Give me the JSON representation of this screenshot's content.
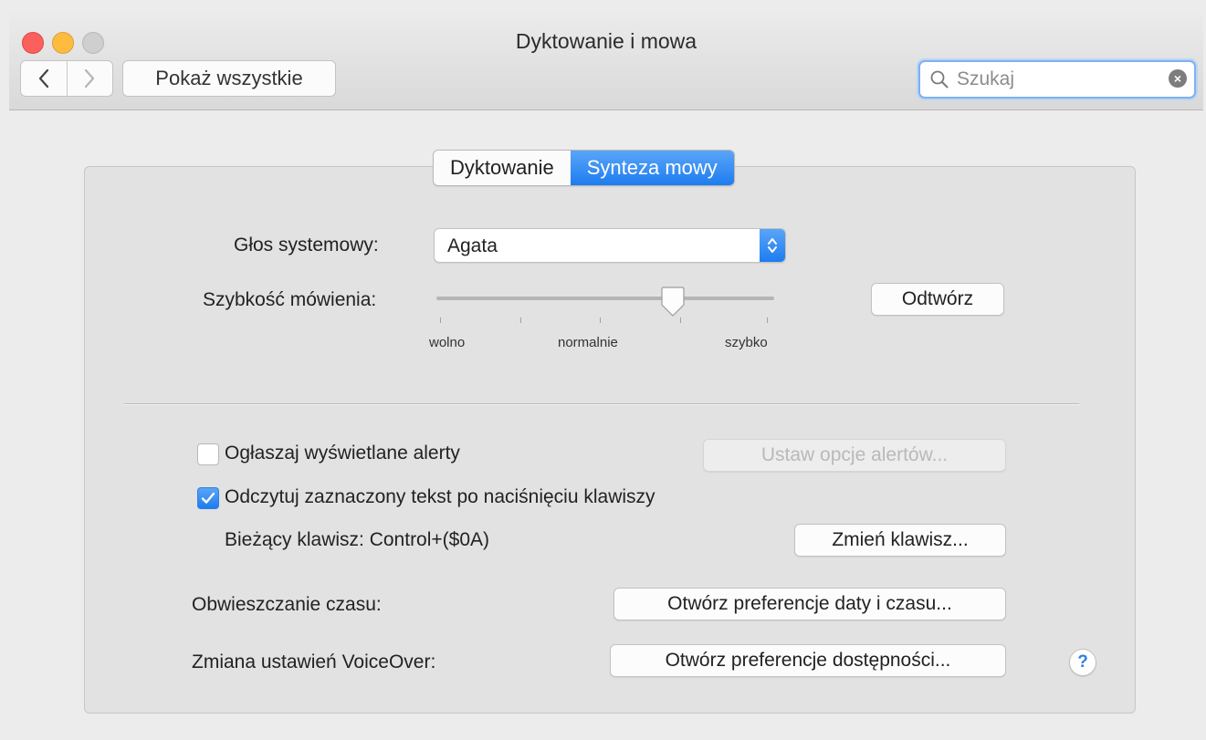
{
  "window": {
    "title": "Dyktowanie i mowa"
  },
  "toolbar": {
    "back_label": "<",
    "forward_label": ">",
    "show_all_label": "Pokaż wszystkie",
    "search_placeholder": "Szukaj"
  },
  "tabs": [
    {
      "label": "Dyktowanie",
      "active": false
    },
    {
      "label": "Synteza mowy",
      "active": true
    }
  ],
  "voice": {
    "label": "Głos systemowy:",
    "value": "Agata"
  },
  "rate": {
    "label": "Szybkość mówienia:",
    "min_label": "wolno",
    "mid_label": "normalnie",
    "max_label": "szybko",
    "level": 0.7,
    "play_button": "Odtwórz"
  },
  "alerts": {
    "label": "Ogłaszaj wyświetlane alerty",
    "checked": false,
    "options_button": "Ustaw opcje alertów..."
  },
  "speak_selection": {
    "label": "Odczytuj zaznaczony tekst po naciśnięciu klawiszy",
    "checked": true,
    "current_key_label": "Bieżący klawisz: Control+($0A)",
    "change_key_button": "Zmień klawisz..."
  },
  "time": {
    "label": "Obwieszczanie czasu:",
    "button": "Otwórz preferencje daty i czasu..."
  },
  "voiceover": {
    "label": "Zmiana ustawień VoiceOver:",
    "button": "Otwórz preferencje dostępności..."
  },
  "help": {
    "label": "?"
  },
  "colors": {
    "accent": "#1e7cef",
    "close": "#fc605c",
    "minimize": "#fdbc40",
    "zoom_inactive": "#cfcfcf"
  }
}
